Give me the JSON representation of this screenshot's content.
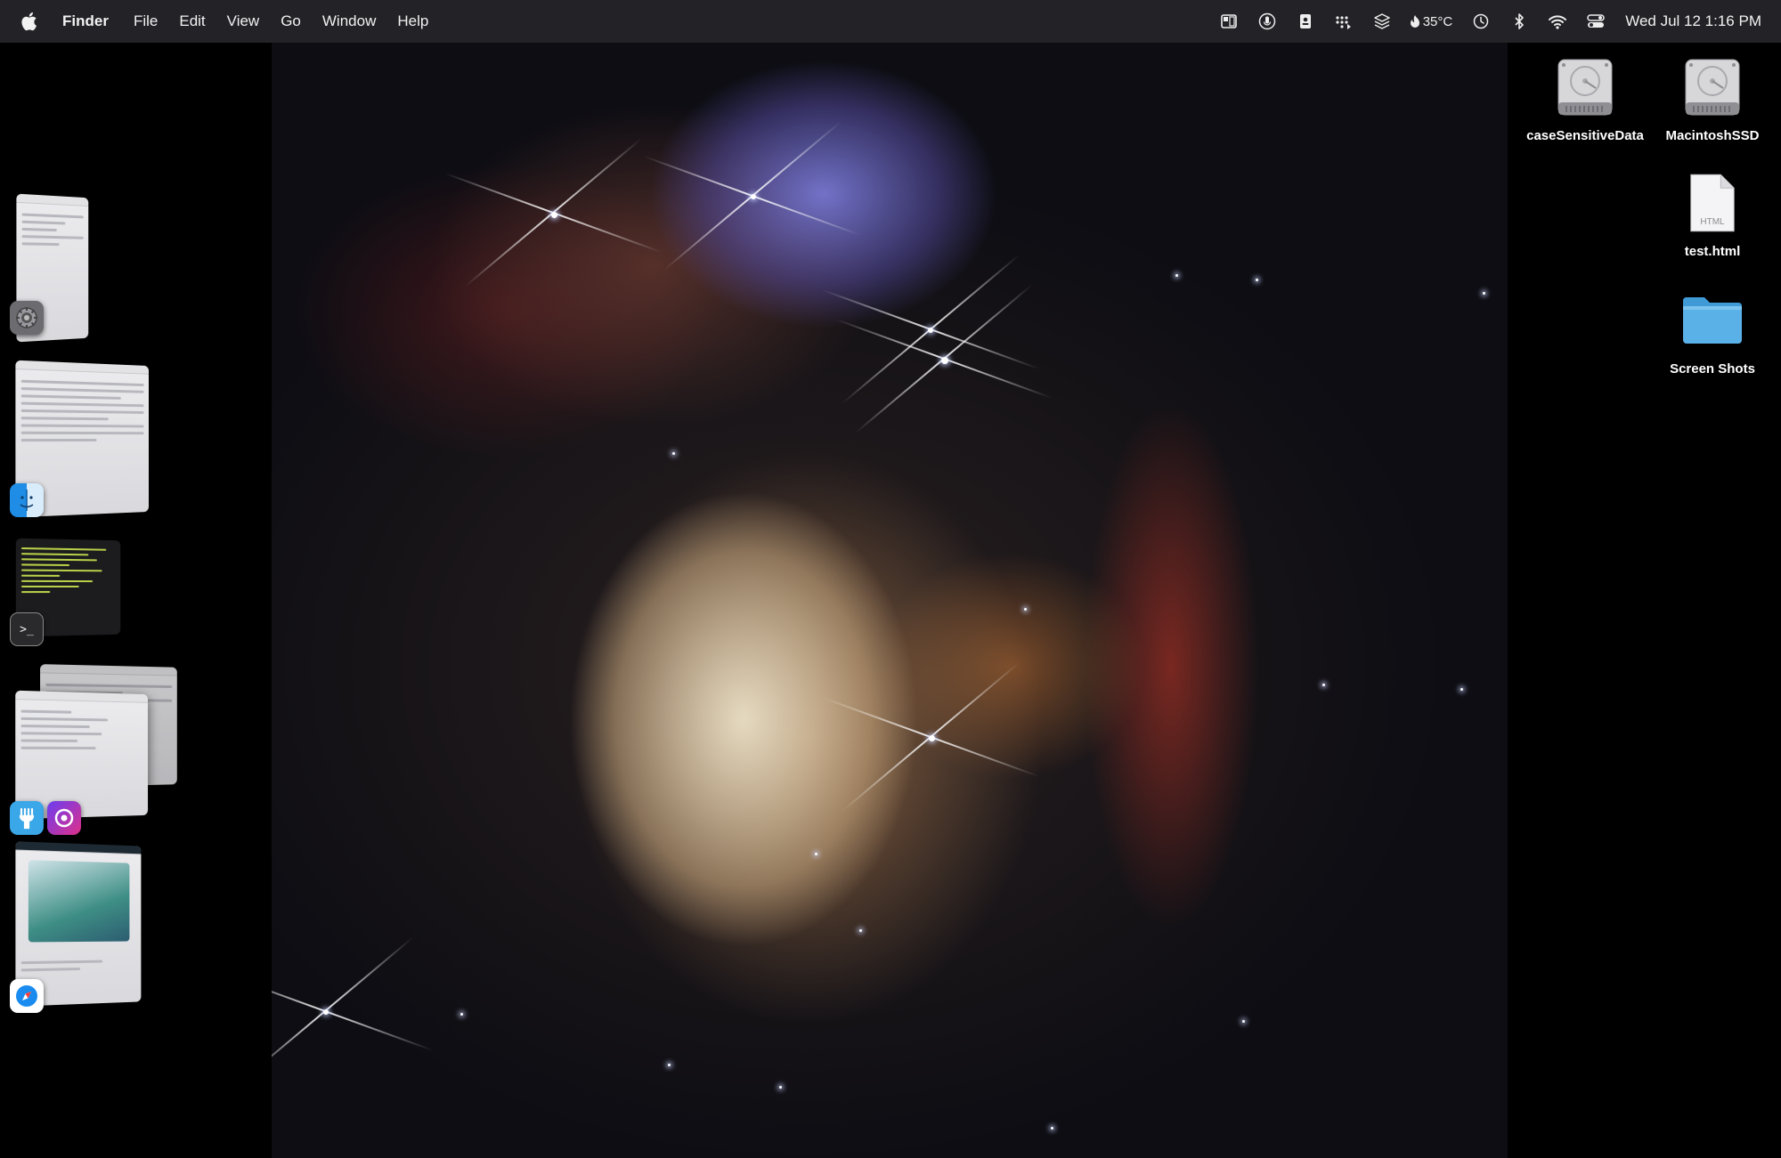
{
  "menubar": {
    "apple_icon": "apple-logo-icon",
    "app_name": "Finder",
    "items": [
      "File",
      "Edit",
      "View",
      "Go",
      "Window",
      "Help"
    ],
    "status": {
      "temperature": "35°C",
      "datetime": "Wed Jul 12  1:16 PM"
    }
  },
  "stage_manager": {
    "groups": [
      {
        "app": "System Settings",
        "icon": "gear-icon"
      },
      {
        "app": "Finder",
        "icon": "finder-face-icon"
      },
      {
        "app": "Terminal",
        "icon": "terminal-icon"
      },
      {
        "app": "Fork",
        "icon": "fork-icon"
      },
      {
        "app": "Screen Capture",
        "icon": "camera-lens-icon"
      },
      {
        "app": "Safari",
        "icon": "compass-icon"
      }
    ],
    "terminal_prompt": ">_"
  },
  "desktop": {
    "items": [
      {
        "label": "caseSensitiveData",
        "icon": "hard-drive-icon"
      },
      {
        "label": "MacintoshSSD",
        "icon": "hard-drive-icon"
      },
      {
        "label": "test.html",
        "icon": "html-file-icon",
        "file_badge": "HTML"
      },
      {
        "label": "Screen Shots",
        "icon": "folder-icon"
      }
    ]
  },
  "colors": {
    "menubar_bg": "#222227",
    "folder_blue": "#5ab1e8"
  }
}
